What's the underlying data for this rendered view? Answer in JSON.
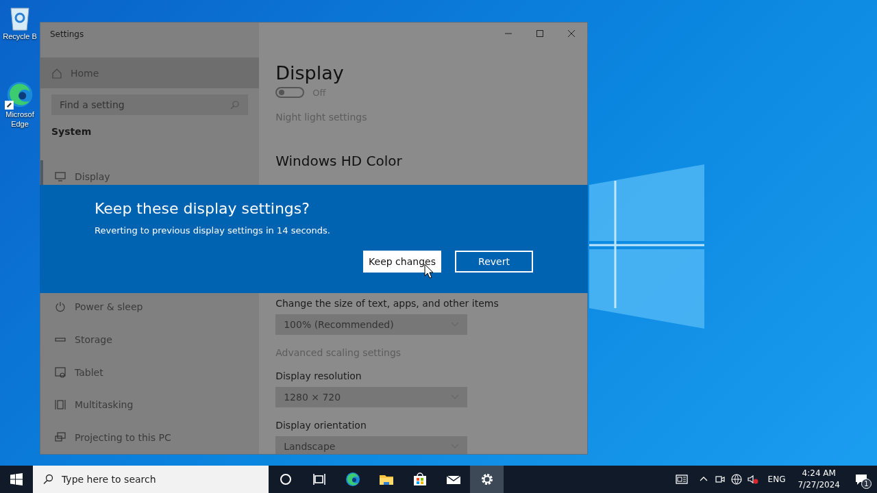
{
  "desktop": {
    "icons": [
      {
        "kind": "recycle",
        "lines": [
          "Recycle B"
        ]
      },
      {
        "kind": "edge",
        "lines": [
          "Microsof",
          "Edge"
        ]
      }
    ]
  },
  "window": {
    "title": "Settings",
    "sidebar": {
      "home": {
        "label": "Home",
        "selected": false
      },
      "search": {
        "placeholder": "Find a setting"
      },
      "section": "System",
      "items": [
        {
          "label": "Display",
          "selected": true
        },
        {
          "label": "Power & sleep",
          "selected": false
        },
        {
          "label": "Storage",
          "selected": false
        },
        {
          "label": "Tablet",
          "selected": false
        },
        {
          "label": "Multitasking",
          "selected": false
        },
        {
          "label": "Projecting to this PC",
          "selected": false
        }
      ]
    },
    "content": {
      "heading": "Display",
      "blocks": [
        {
          "kind": "toggle",
          "on": false,
          "label": "Off"
        },
        {
          "kind": "link",
          "label": "Night light settings"
        },
        {
          "kind": "heading",
          "label": "Windows HD Color"
        },
        {
          "kind": "label",
          "label": "Change the size of text, apps, and other items"
        },
        {
          "kind": "dropdown",
          "value": "100% (Recommended)"
        },
        {
          "kind": "link",
          "label": "Advanced scaling settings"
        },
        {
          "kind": "label",
          "label": "Display resolution"
        },
        {
          "kind": "dropdown",
          "value": "1280 × 720"
        },
        {
          "kind": "label",
          "label": "Display orientation"
        },
        {
          "kind": "dropdown",
          "value": "Landscape"
        }
      ]
    }
  },
  "dialog": {
    "title": "Keep these display settings?",
    "message": "Reverting to previous display settings in 14 seconds.",
    "buttons": [
      {
        "label": "Keep changes",
        "kind": "filled"
      },
      {
        "label": "Revert",
        "kind": "outline"
      }
    ]
  },
  "taskbar": {
    "search": {
      "placeholder": "Type here to search"
    },
    "apps": [
      {
        "kind": "cortana",
        "active": false
      },
      {
        "kind": "taskview",
        "active": false
      },
      {
        "kind": "edge",
        "active": false
      },
      {
        "kind": "explorer",
        "active": false
      },
      {
        "kind": "store",
        "active": false
      },
      {
        "kind": "mail",
        "active": false
      },
      {
        "kind": "settings",
        "active": true
      }
    ],
    "tray": {
      "language": "ENG",
      "time": "4:24 AM",
      "date": "7/27/2024",
      "notifications": "1"
    }
  }
}
